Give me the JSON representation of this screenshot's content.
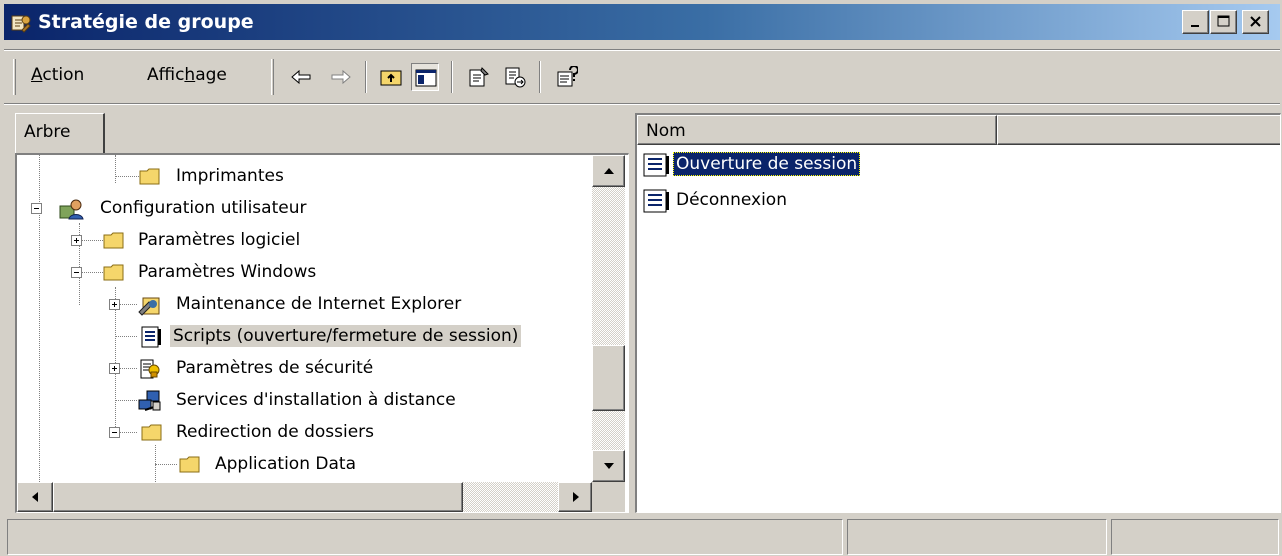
{
  "window": {
    "title": "Stratégie de groupe",
    "title_icon": "group-policy-icon",
    "buttons": [
      "minimize-icon",
      "maximize-icon",
      "close-icon"
    ]
  },
  "menu": {
    "items": [
      {
        "label": "Action",
        "mnemonic": "A"
      },
      {
        "label": "Affichage",
        "mnemonic": "h"
      }
    ]
  },
  "toolbar": {
    "icons": [
      "back-arrow-icon",
      "forward-arrow-icon",
      "up-folder-icon",
      "show-hide-tree-icon",
      "properties-icon",
      "export-list-icon",
      "help-icon"
    ]
  },
  "tree_tab": {
    "label": "Arbre"
  },
  "tree": {
    "nodes": [
      {
        "label": "Imprimantes",
        "icon": "folder-icon"
      },
      {
        "label": "Configuration utilisateur",
        "icon": "user-config-icon"
      },
      {
        "label": "Paramètres logiciel",
        "icon": "folder-icon"
      },
      {
        "label": "Paramètres Windows",
        "icon": "folder-icon"
      },
      {
        "label": "Maintenance de Internet Explorer",
        "icon": "ie-maintenance-icon"
      },
      {
        "label": "Scripts (ouverture/fermeture de session)",
        "icon": "script-icon",
        "selected": true
      },
      {
        "label": "Paramètres de sécurité",
        "icon": "security-icon"
      },
      {
        "label": "Services d'installation à distance",
        "icon": "remote-install-icon"
      },
      {
        "label": "Redirection de dossiers",
        "icon": "folder-icon"
      },
      {
        "label": "Application Data",
        "icon": "folder-icon"
      }
    ]
  },
  "list": {
    "columns": [
      "Nom",
      ""
    ],
    "items": [
      {
        "label": "Ouverture de session",
        "icon": "script-icon",
        "selected": true
      },
      {
        "label": "Déconnexion",
        "icon": "script-icon",
        "selected": false
      }
    ]
  },
  "statusbar": {
    "panels": [
      "",
      "",
      ""
    ]
  },
  "colors": {
    "title_start": "#0a246a",
    "title_end": "#a6caf0",
    "face": "#d4d0c8",
    "selection": "#0a246a",
    "folder": "#f5d66b"
  }
}
